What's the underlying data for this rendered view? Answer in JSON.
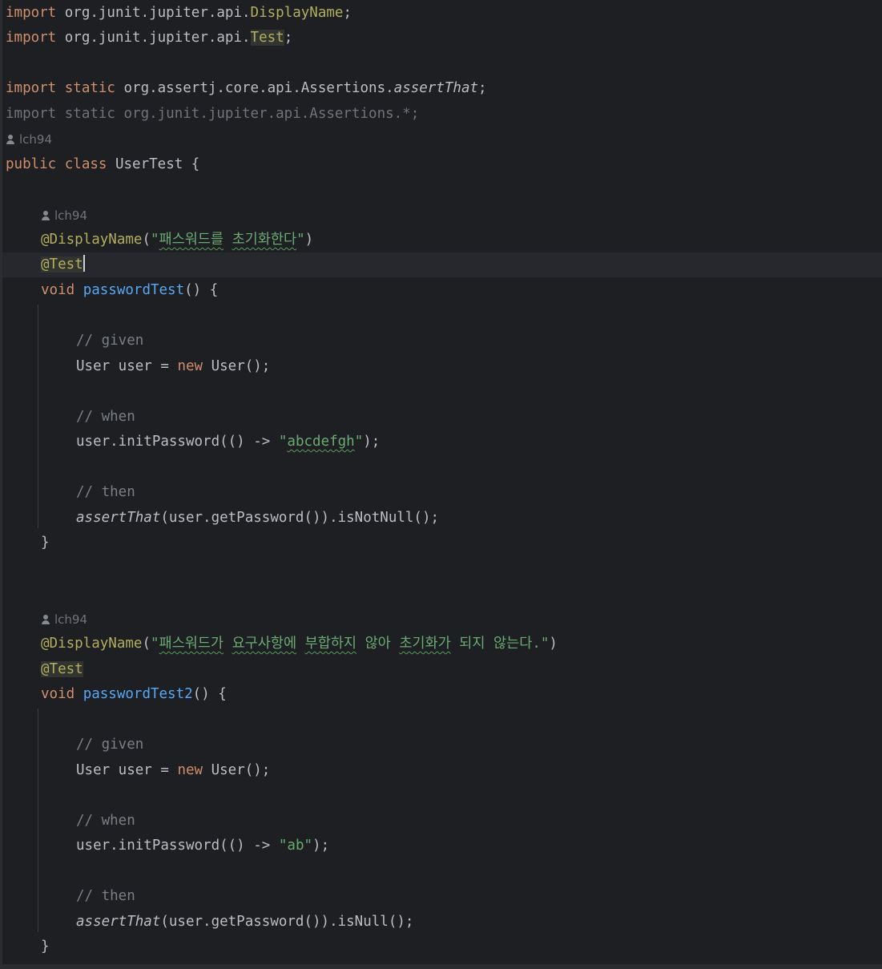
{
  "editor": {
    "imports": {
      "line1_kw": "import",
      "line1_pkg": " org.junit.jupiter.api.",
      "line1_cls": "DisplayName",
      "line1_end": ";",
      "line2_kw": "import",
      "line2_pkg": " org.junit.jupiter.api.",
      "line2_cls": "Test",
      "line2_end": ";",
      "line3_kw": "import static",
      "line3_pkg": " org.assertj.core.api.Assertions.",
      "line3_method": "assertThat",
      "line3_end": ";",
      "line4_text": "import static org.junit.jupiter.api.Assertions.*;"
    },
    "class": {
      "author": "lch94",
      "kw": "public class",
      "name": " UserTest {"
    },
    "test1": {
      "author": "lch94",
      "annotation": "@DisplayName",
      "open": "(",
      "q_open": "\"",
      "display_word1": "패스워드를",
      "space": " ",
      "display_word2": "초기화한다",
      "q_close": "\"",
      "close": ")",
      "test_ann": "@Test",
      "void_kw": "void",
      "method": "passwordTest",
      "sig_end": "() {",
      "comment_given": "// given",
      "user_decl": "User user = ",
      "new_kw": "new",
      "user_ctor": " User();",
      "comment_when": "// when",
      "call_start": "user.initPassword(() -> ",
      "arg_q1": "\"",
      "arg_value": "abcdefgh",
      "arg_q2": "\"",
      "call_end": ");",
      "comment_then": "// then",
      "assert_fn": "assertThat",
      "assert_rest": "(user.getPassword()).isNotNull();",
      "brace": "}"
    },
    "test2": {
      "author": "lch94",
      "annotation": "@DisplayName",
      "open": "(",
      "q_open": "\"",
      "w1": "패스워드가",
      "w2": "요구사항에",
      "w3": "부합하지",
      "w4": "않아",
      "w5": "초기화가",
      "w6": "되지",
      "w7": "않는다.",
      "q_close": "\"",
      "close": ")",
      "test_ann": "@Test",
      "void_kw": "void",
      "method": "passwordTest2",
      "sig_end": "() {",
      "comment_given": "// given",
      "user_decl": "User user = ",
      "new_kw": "new",
      "user_ctor": " User();",
      "comment_when": "// when",
      "call_start": "user.initPassword(() -> ",
      "arg_str": "\"ab\"",
      "call_end": ");",
      "comment_then": "// then",
      "assert_fn": "assertThat",
      "assert_rest": "(user.getPassword()).isNull();",
      "brace": "}"
    },
    "icons": {
      "author": "person-icon"
    },
    "colors": {
      "background": "#1e1f22",
      "keyword": "#cf8e6d",
      "annotation": "#b3ae60",
      "string": "#6aab73",
      "comment": "#7a7e85",
      "method": "#56a8f5",
      "text": "#bcbec4"
    }
  }
}
